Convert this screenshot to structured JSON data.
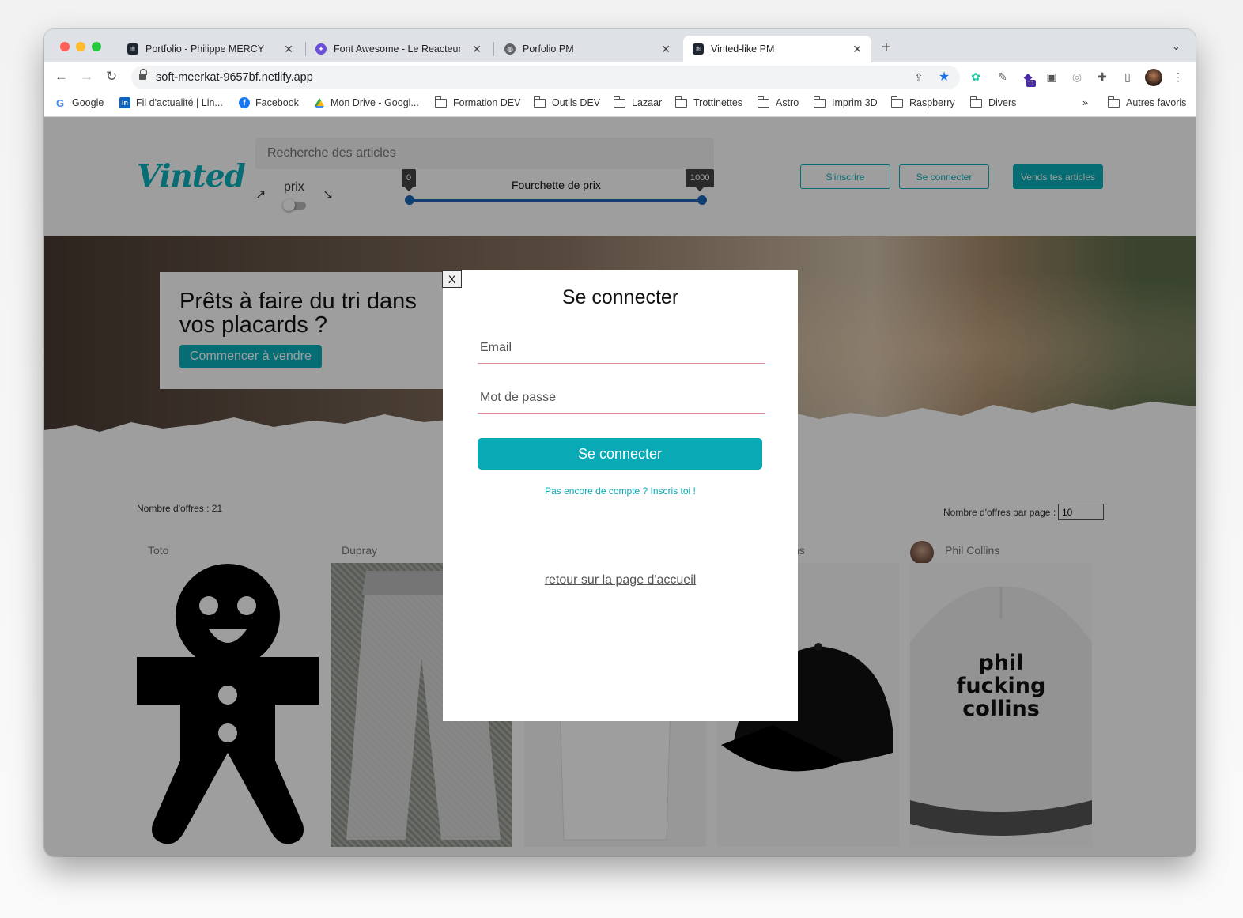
{
  "browser": {
    "tabs": [
      {
        "title": "Portfolio - Philippe MERCY",
        "close": "✕"
      },
      {
        "title": "Font Awesome - Le Reacteur",
        "close": "✕"
      },
      {
        "title": "Porfolio PM",
        "close": "✕"
      },
      {
        "title": "Vinted-like PM",
        "close": "✕"
      }
    ],
    "new_tab": "+",
    "tab_menu": "⌄",
    "url": "soft-meerkat-9657bf.netlify.app",
    "bookmarks": [
      {
        "label": "Google"
      },
      {
        "label": "Fil d'actualité | Lin..."
      },
      {
        "label": "Facebook"
      },
      {
        "label": "Mon Drive - Googl..."
      },
      {
        "label": "Formation DEV"
      },
      {
        "label": "Outils DEV"
      },
      {
        "label": "Lazaar"
      },
      {
        "label": "Trottinettes"
      },
      {
        "label": "Astro"
      },
      {
        "label": "Imprim 3D"
      },
      {
        "label": "Raspberry"
      },
      {
        "label": "Divers"
      }
    ],
    "bookmarks_more": "»",
    "other_bookmarks": "Autres favoris",
    "ext_badge": "11"
  },
  "header": {
    "logo": "Vinted",
    "search_placeholder": "Recherche des articles",
    "sort_up": "↗",
    "sort_down": "↘",
    "price_label": "prix",
    "range_label": "Fourchette de prix",
    "range_min": "0",
    "range_max": "1000",
    "signup": "S'inscrire",
    "login": "Se connecter",
    "sell": "Vends tes articles"
  },
  "hero": {
    "title": "Prêts à faire du tri dans vos placards ?",
    "cta": "Commencer à vendre"
  },
  "offers": {
    "count_label": "Nombre d'offres : 21",
    "per_page_label": "Nombre d'offres par page :",
    "per_page_value": "10",
    "cards": [
      {
        "user": "Toto"
      },
      {
        "user": "Dupray"
      },
      {
        "user": ""
      },
      {
        "user": "ns"
      },
      {
        "user": "Phil Collins",
        "cap_text": [
          "phil",
          "fucking",
          "collins"
        ]
      }
    ]
  },
  "modal": {
    "close": "X",
    "title": "Se connecter",
    "email_placeholder": "Email",
    "password_placeholder": "Mot de passe",
    "submit": "Se connecter",
    "signup_link": "Pas encore de compte ? Inscris toi !",
    "back_link": "retour sur la page d'accueil"
  },
  "colors": {
    "brand": "#09b1ba",
    "overlay": "rgba(0,0,0,0.38)",
    "input_underline": "#e38a96"
  }
}
